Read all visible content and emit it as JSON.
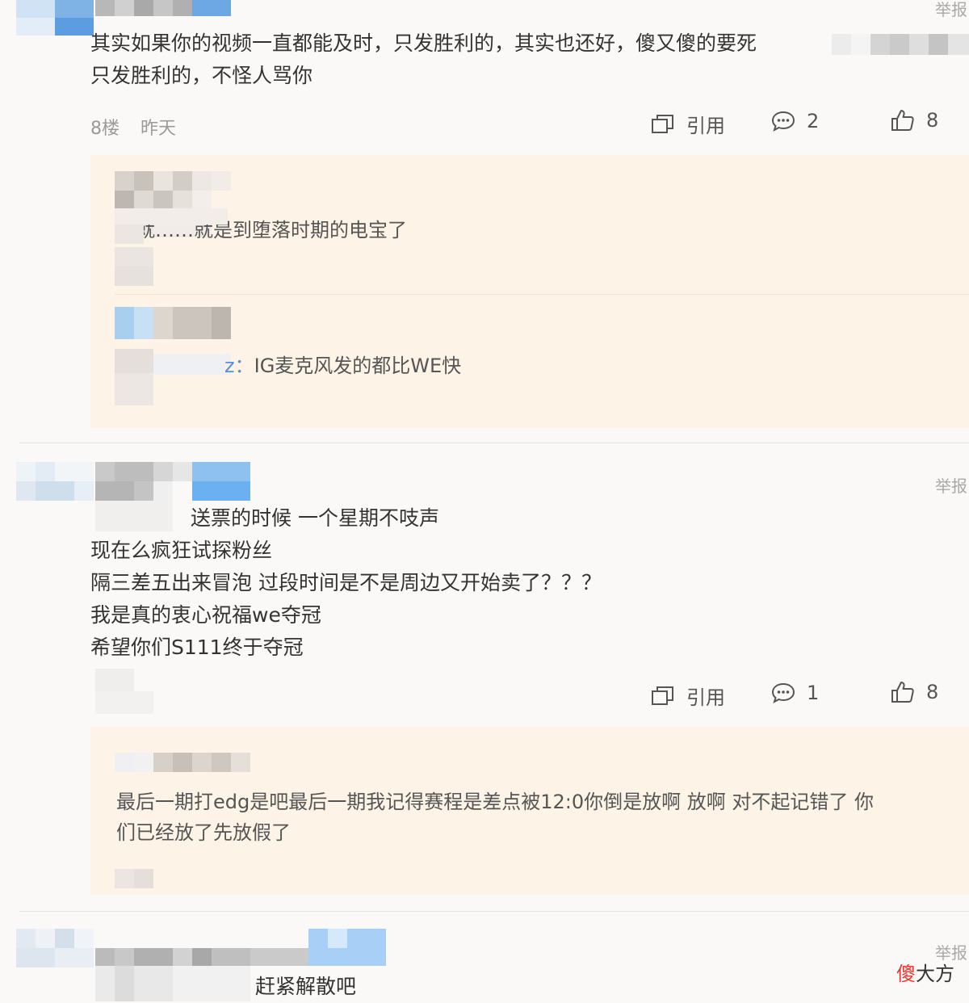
{
  "comments": [
    {
      "report": "举报",
      "text": [
        "其实如果你的视频一直都能及时，只发胜利的，其实也还好，傻又傻的要死",
        "只发胜利的，不怪人骂你"
      ],
      "floor": "8楼",
      "time": "昨天",
      "quote_label": "引用",
      "reply_count": "2",
      "like_count": "8",
      "replies": [
        {
          "text": "这就……就是到堕落时期的电宝了"
        },
        {
          "user_suffix": "z：",
          "text": "IG麦克风发的都比WE快"
        }
      ]
    },
    {
      "report": "举报",
      "text": [
        "送票的时候 一个星期不吱声",
        "现在么疯狂试探粉丝",
        "隔三差五出来冒泡 过段时间是不是周边又开始卖了？？？",
        "我是真的衷心祝福we夺冠",
        "希望你们S111终于夺冠"
      ],
      "quote_label": "引用",
      "reply_count": "1",
      "like_count": "8",
      "replies": [
        {
          "text": [
            "最后一期打edg是吧最后一期我记得赛程是差点被12:0你倒是放啊 放啊 对不起记错了 你",
            "们已经放了先放假了"
          ]
        }
      ]
    },
    {
      "report": "举报",
      "text": [
        "赶紧解散吧"
      ]
    }
  ],
  "watermark": {
    "brand_red": "傻",
    "brand_rest": "大方"
  },
  "colors": {
    "reply_bg": "#fdf3e6",
    "page_bg": "#fbf9f7",
    "link_blue": "#5a8fd8",
    "brand_red": "#e53935"
  },
  "icons": [
    "quote-icon",
    "comment-icon",
    "thumbs-up-icon"
  ]
}
